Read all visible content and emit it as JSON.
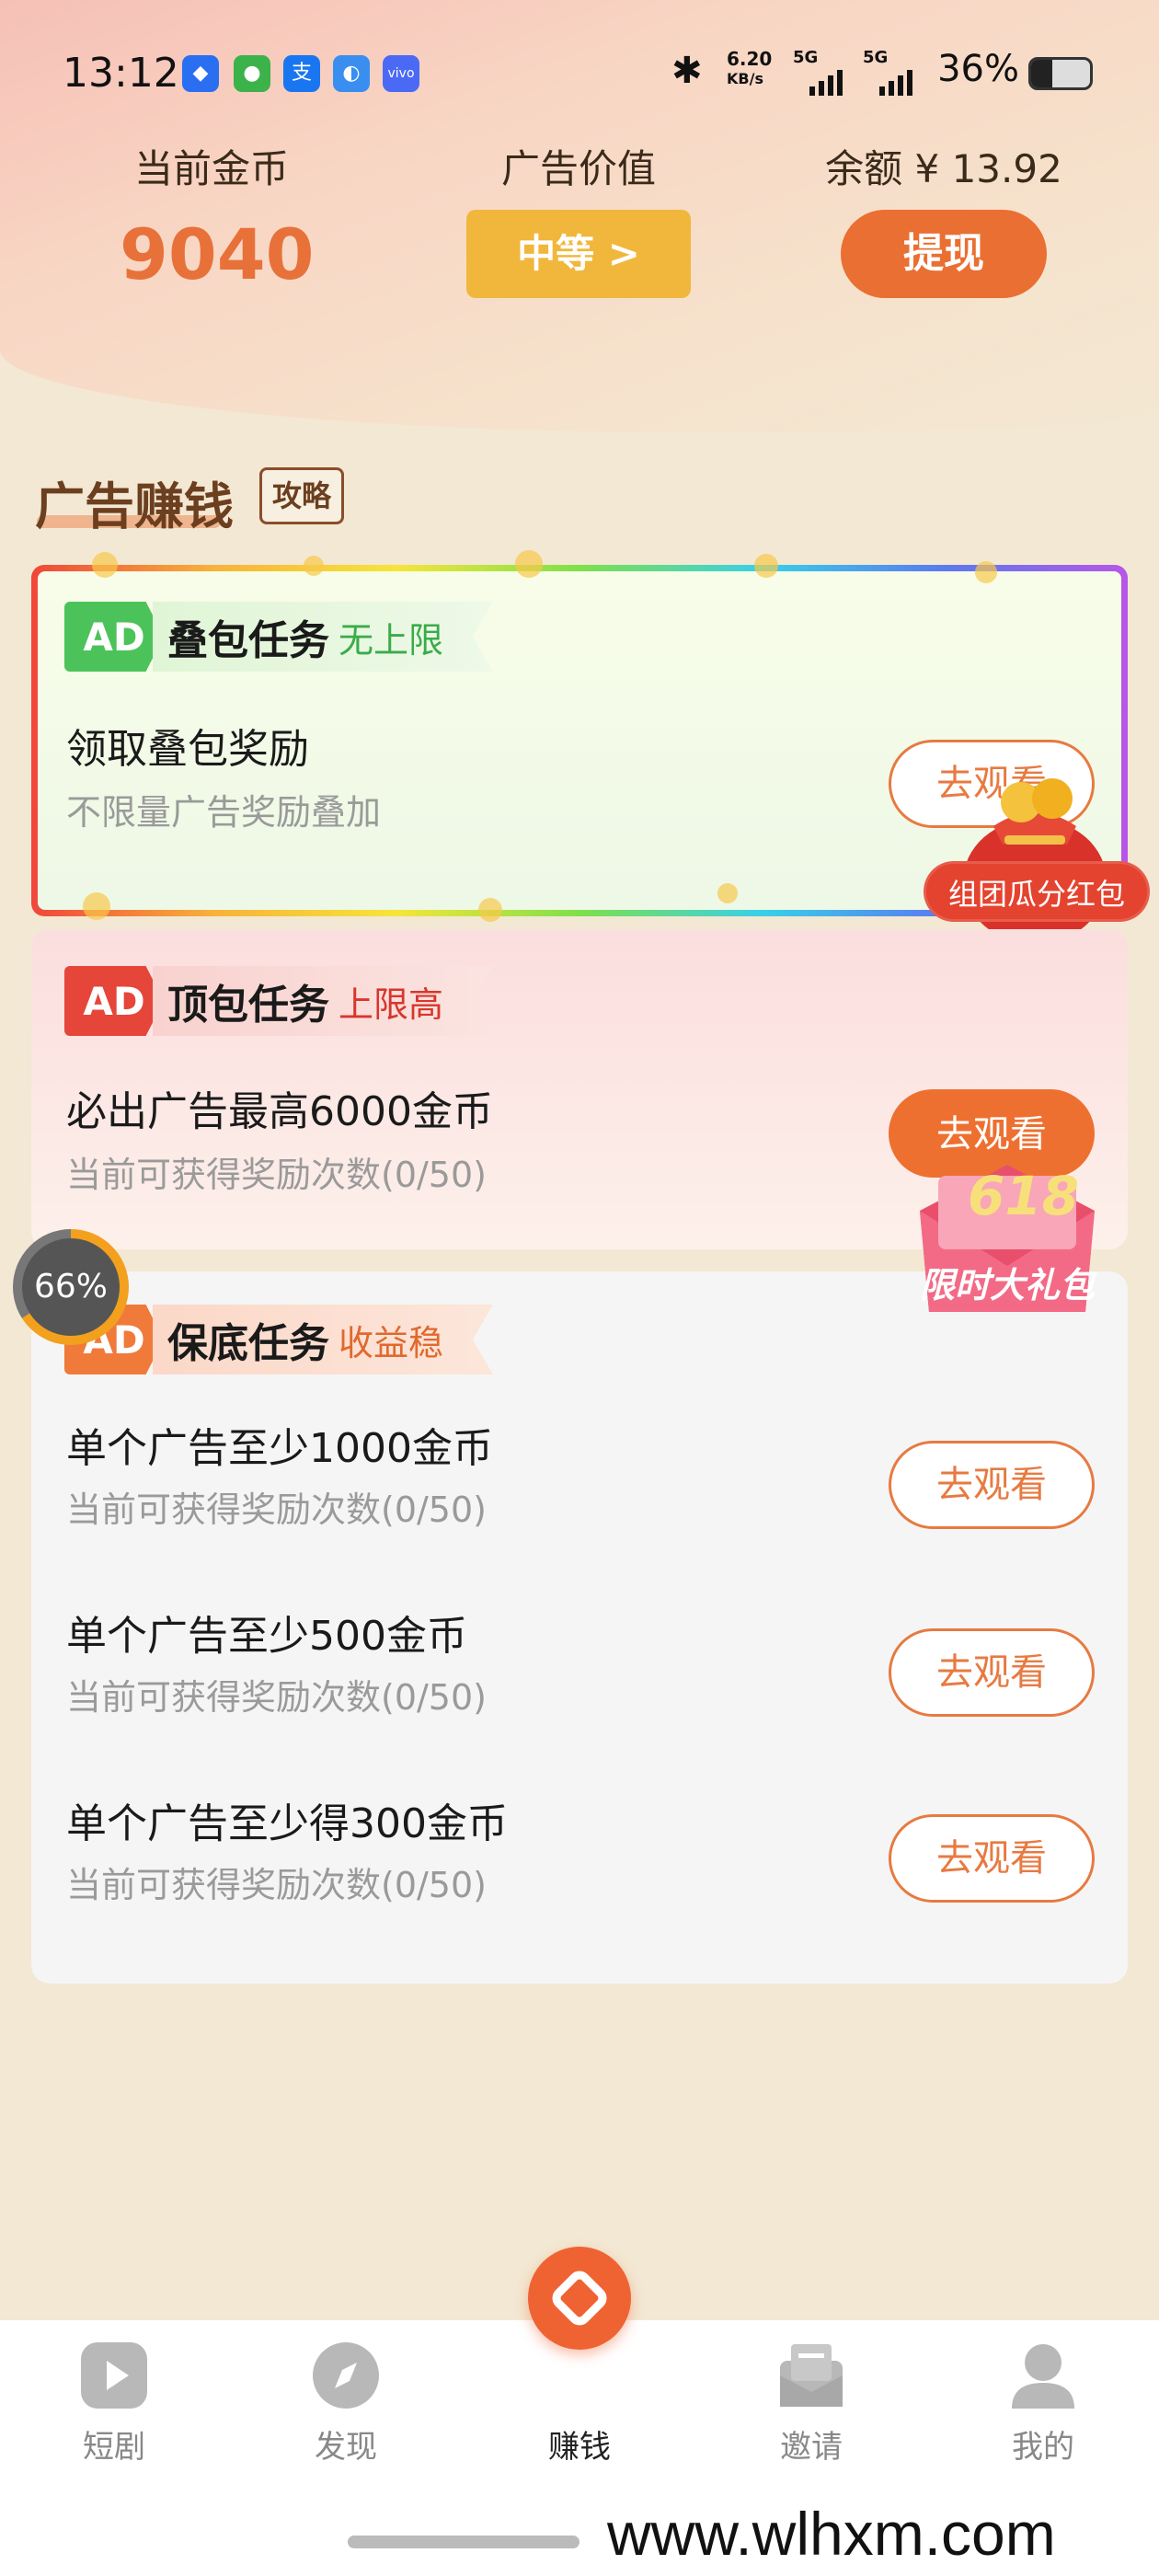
{
  "status_bar": {
    "time": "13:12",
    "net_speed": "6.20",
    "net_speed_unit": "KB/s",
    "signal1": "5G",
    "signal2": "5G",
    "battery": "36%",
    "battery_level": 0.36
  },
  "header": {
    "coins_label": "当前金币",
    "coins_value": "9040",
    "ad_value_label": "广告价值",
    "ad_value_button": "中等 >",
    "balance_label": "余额 ¥ 13.92",
    "withdraw_button": "提现"
  },
  "section": {
    "title": "广告赚钱",
    "guide_badge": "攻略"
  },
  "tasks": {
    "stack": {
      "tag_ad": "AD",
      "name": "叠包任务",
      "sub": "无上限",
      "title": "领取叠包奖励",
      "desc": "不限量广告奖励叠加",
      "button": "去观看"
    },
    "top": {
      "tag_ad": "AD",
      "name": "顶包任务",
      "sub": "上限高",
      "title": "必出广告最高6000金币",
      "desc": "当前可获得奖励次数(0/50)",
      "button": "去观看"
    },
    "base": {
      "tag_ad": "AD",
      "name": "保底任务",
      "sub": "收益稳",
      "rows": [
        {
          "title": "单个广告至少1000金币",
          "desc": "当前可获得奖励次数(0/50)",
          "button": "去观看"
        },
        {
          "title": "单个广告至少500金币",
          "desc": "当前可获得奖励次数(0/50)",
          "button": "去观看"
        },
        {
          "title": "单个广告至少得300金币",
          "desc": "当前可获得奖励次数(0/50)",
          "button": "去观看"
        }
      ]
    }
  },
  "floating": {
    "red_packet_label": "组团瓜分红包",
    "gift_number": "618",
    "gift_label": "限时大礼包",
    "progress_text": "66%",
    "progress_level": 0.66
  },
  "nav": {
    "items": [
      {
        "label": "短剧",
        "icon": "play-icon"
      },
      {
        "label": "发现",
        "icon": "compass-icon"
      },
      {
        "label": "赚钱",
        "icon": "diamond-icon",
        "active": true
      },
      {
        "label": "邀请",
        "icon": "mail-icon"
      },
      {
        "label": "我的",
        "icon": "user-icon"
      }
    ]
  },
  "watermark": "www.wlhxm.com",
  "colors": {
    "accent_orange": "#ee7030",
    "gold": "#f1b73c",
    "ad_green": "#4cc35a",
    "ad_red": "#e6453a",
    "ad_orange": "#f07a3a"
  }
}
